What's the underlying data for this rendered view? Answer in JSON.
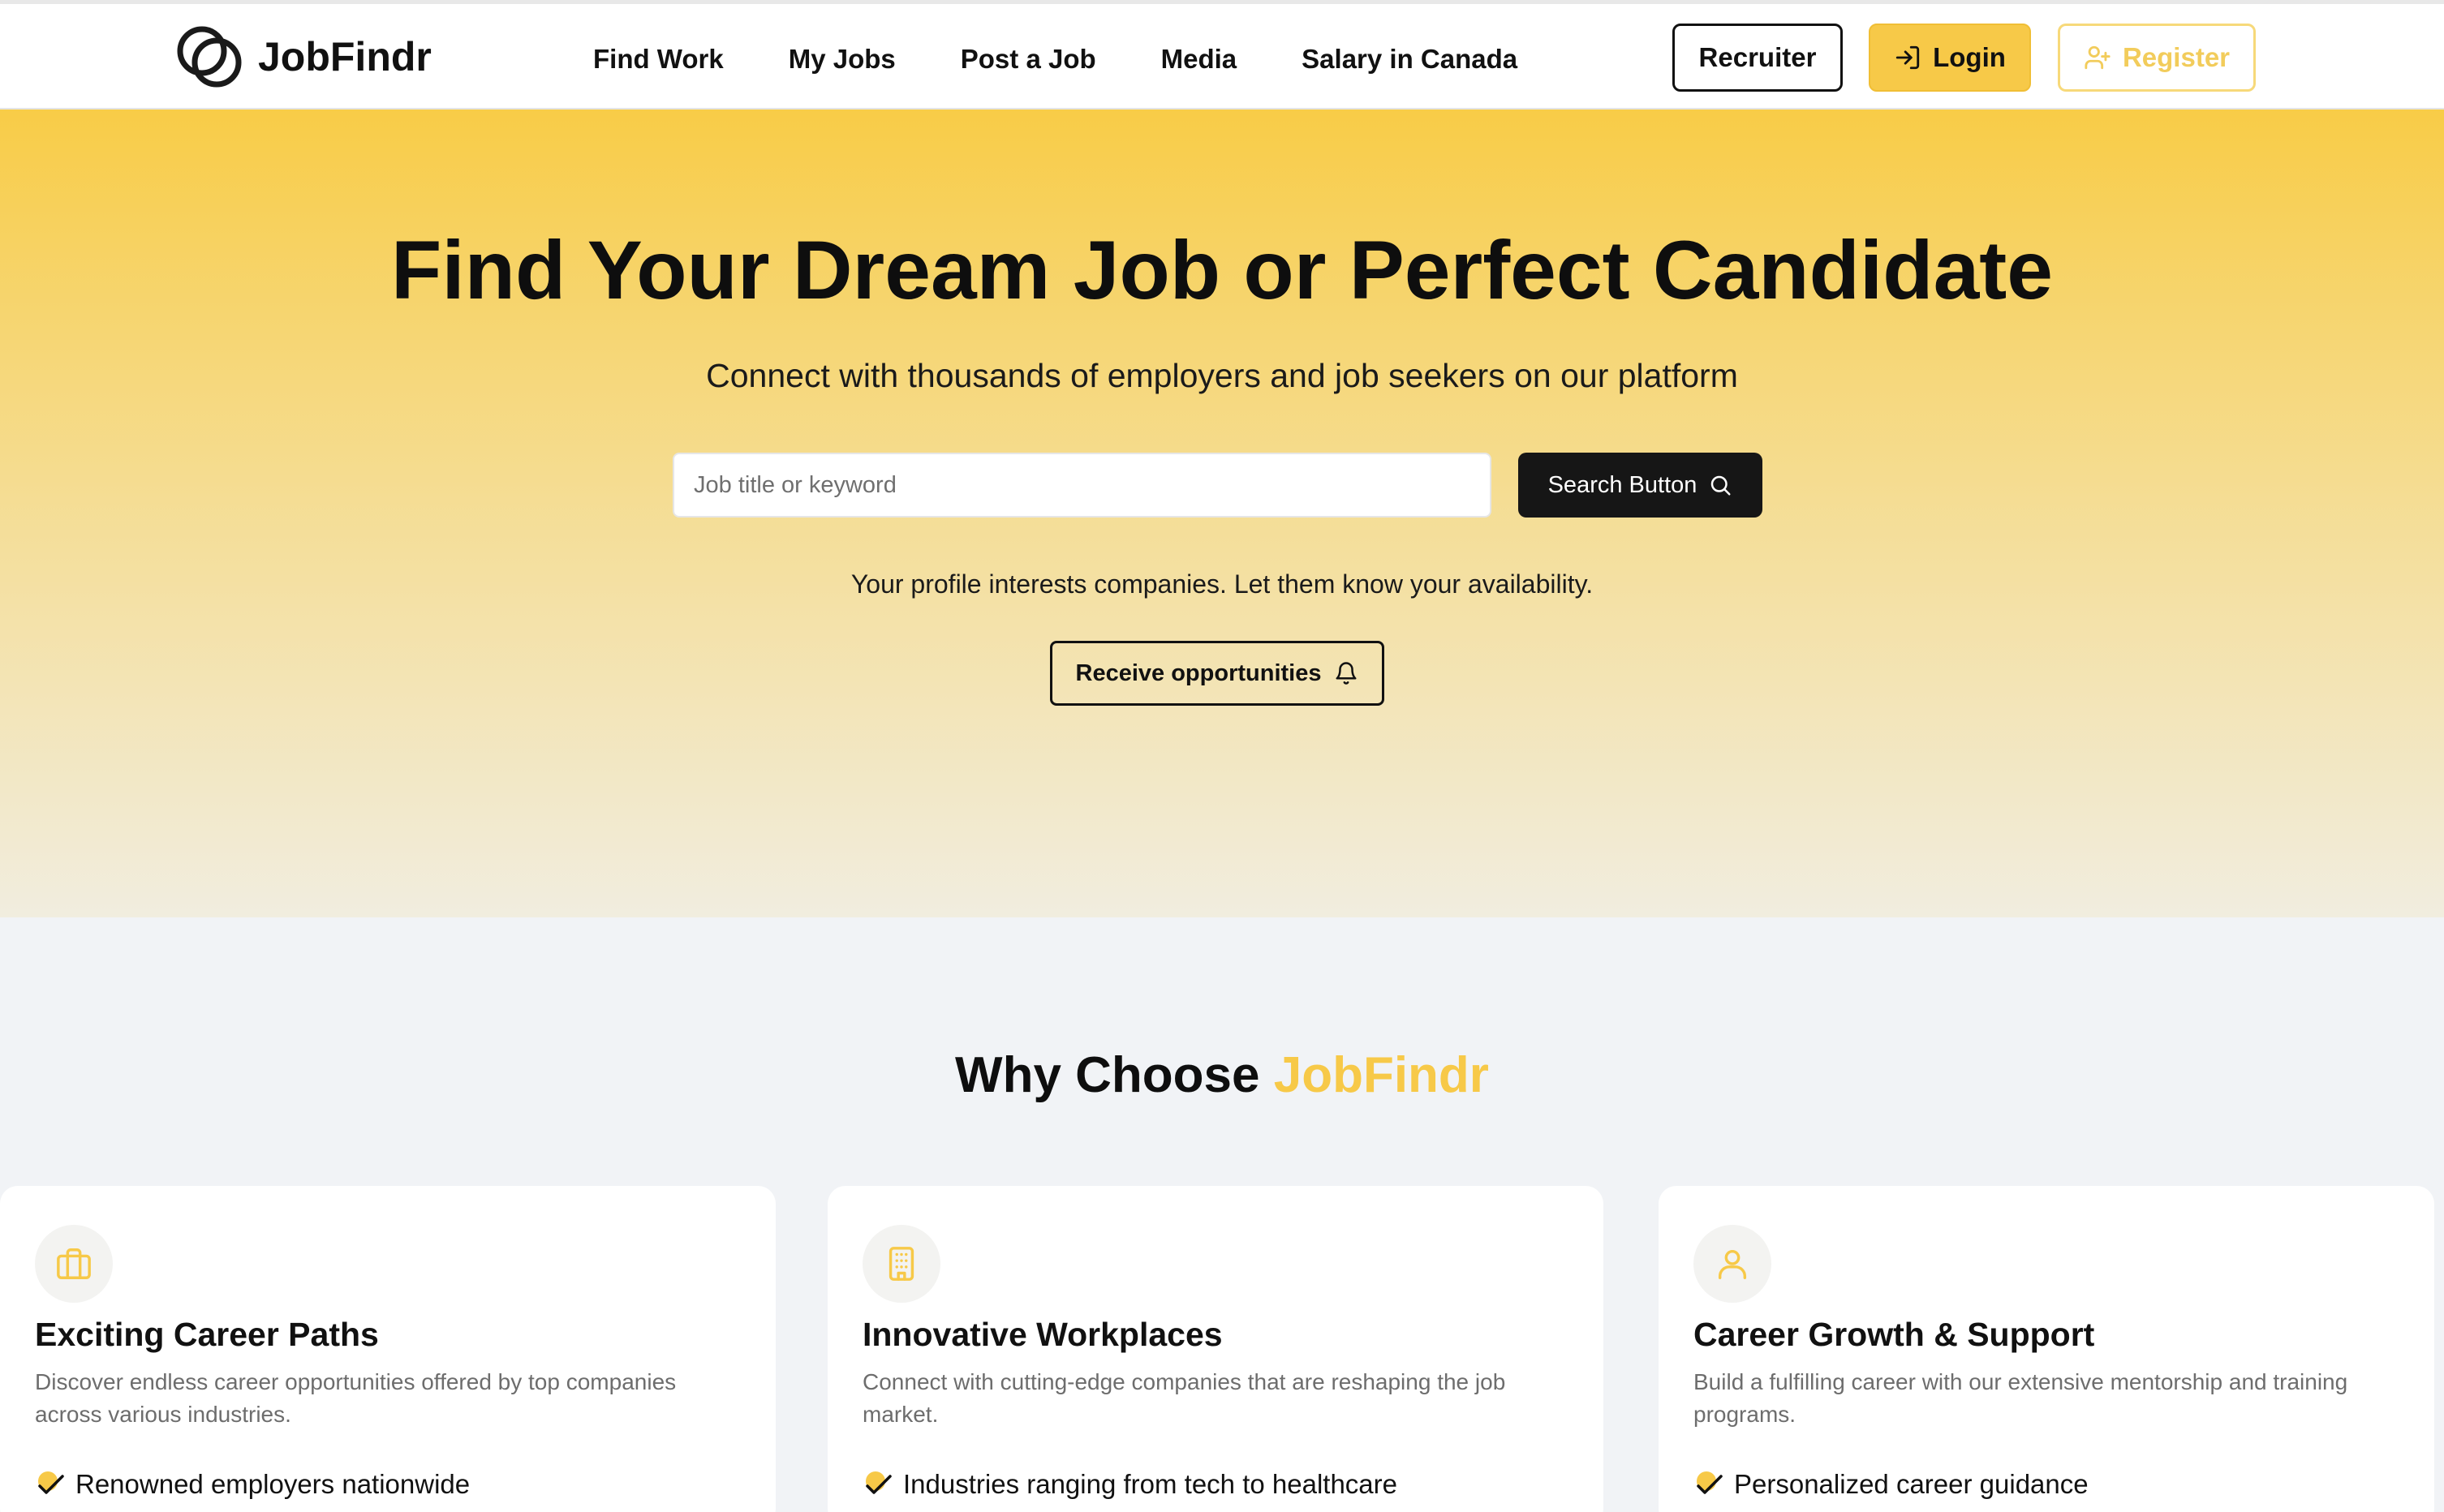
{
  "header": {
    "brand": "JobFindr",
    "nav": [
      "Find Work",
      "My Jobs",
      "Post a Job",
      "Media",
      "Salary in Canada"
    ],
    "recruiter_label": "Recruiter",
    "login_label": "Login",
    "register_label": "Register"
  },
  "hero": {
    "title": "Find Your Dream Job or Perfect Candidate",
    "subtitle": "Connect with thousands of employers and job seekers on our platform",
    "search_placeholder": "Job title or keyword",
    "search_button": "Search Button",
    "note": "Your profile interests companies. Let them know your availability.",
    "receive_button": "Receive opportunities"
  },
  "why": {
    "title_prefix": "Why Choose",
    "title_brand": "JobFindr",
    "cards": [
      {
        "icon": "briefcase-icon",
        "title": "Exciting Career Paths",
        "description": "Discover endless career opportunities offered by top companies across various industries.",
        "point": "Renowned employers nationwide"
      },
      {
        "icon": "building-icon",
        "title": "Innovative Workplaces",
        "description": "Connect with cutting-edge companies that are reshaping the job market.",
        "point": "Industries ranging from tech to healthcare"
      },
      {
        "icon": "user-icon",
        "title": "Career Growth & Support",
        "description": "Build a fulfilling career with our extensive mentorship and training programs.",
        "point": "Personalized career guidance"
      }
    ]
  },
  "colors": {
    "accent": "#f7c948",
    "dark": "#161616",
    "background": "#f1f3f6"
  }
}
